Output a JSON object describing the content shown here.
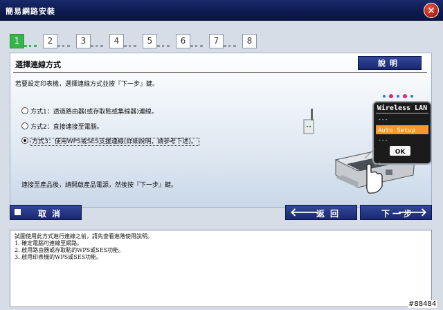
{
  "window": {
    "title": "簡易網路安裝",
    "close_label": "✕"
  },
  "steps": [
    "1",
    "2",
    "3",
    "4",
    "5",
    "6",
    "7",
    "8"
  ],
  "active_step": 1,
  "panel": {
    "title": "選擇連線方式",
    "help_label": "說明",
    "instruction": "若要設定印表機，選擇連線方式並按『下一步』鍵。",
    "options": [
      {
        "label": "方式1：透過路由器(或存取點或集線器)連線。",
        "checked": false
      },
      {
        "label": "方式2：直接連接至電腦。",
        "checked": false
      },
      {
        "label": "方式3：使用WPS或SES支援連線(詳細說明，請參考下述)。",
        "checked": true
      }
    ],
    "after_connect": "連接至產品後，請開啟產品電源，然後按『下一步』鍵。"
  },
  "illustration": {
    "menu_header": "Wireless LAN",
    "menu_items": [
      "---",
      "Auto Setup",
      "---"
    ],
    "selected_item": "Auto Setup",
    "ok_label": "OK",
    "colors": {
      "highlight": "#f39a2a",
      "menu_bg": "#1b1b1b",
      "accent_dot_pink": "#e0287a",
      "accent_dot_blue": "#2b7bd6"
    }
  },
  "buttons": {
    "cancel": "取消",
    "back": "返回",
    "next": "下一步",
    "back_arrow": "🡐",
    "next_arrow": "🡒"
  },
  "info": {
    "lines": [
      "試圖使用此方式進行連線之前，請先查看進階使用說明。",
      "1. 確定電腦可連線至網路。",
      "2. 啟用路由器或存取點的WPS或SES功能。",
      "3. 啟用印表機的WPS或SES功能。"
    ]
  },
  "watermark": "#88484",
  "colors": {
    "title_bar": "#0c1a4f",
    "button": "#1f2e7a",
    "active_step": "#35b54a",
    "background": "#d6dde6"
  }
}
